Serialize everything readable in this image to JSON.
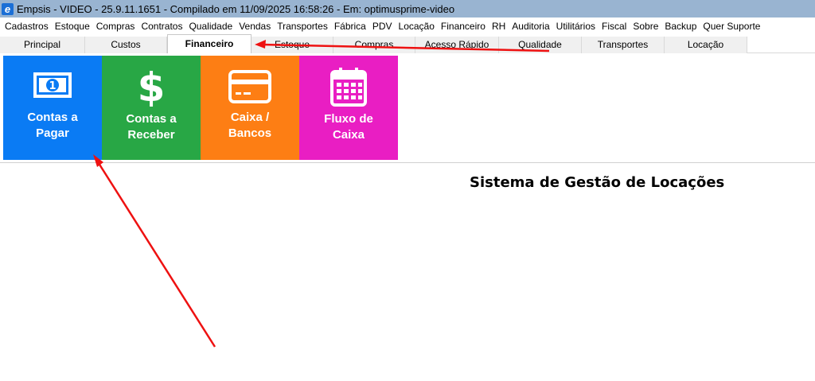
{
  "window": {
    "title": "Empsis - VIDEO - 25.9.11.1651 - Compilado em 11/09/2025 16:58:26 - Em: optimusprime-video",
    "app_icon_letter": "e"
  },
  "menu": [
    "Cadastros",
    "Estoque",
    "Compras",
    "Contratos",
    "Qualidade",
    "Vendas",
    "Transportes",
    "Fábrica",
    "PDV",
    "Locação",
    "Financeiro",
    "RH",
    "Auditoria",
    "Utilitários",
    "Fiscal",
    "Sobre",
    "Backup",
    "Quer Suporte"
  ],
  "tabs": [
    "Principal",
    "Custos",
    "Financeiro",
    "Estoque",
    "Compras",
    "Acesso Rápido",
    "Qualidade",
    "Transportes",
    "Locação"
  ],
  "active_tab": "Financeiro",
  "tiles": [
    {
      "label_line1": "Contas a",
      "label_line2": "Pagar",
      "color": "#0a7bf4",
      "icon": "banknote-icon"
    },
    {
      "label_line1": "Contas a",
      "label_line2": "Receber",
      "color": "#28a745",
      "icon": "dollar-icon"
    },
    {
      "label_line1": "Caixa /",
      "label_line2": "Bancos",
      "color": "#fd7e14",
      "icon": "credit-card-icon"
    },
    {
      "label_line1": "Fluxo de",
      "label_line2": "Caixa",
      "color": "#e91ec3",
      "icon": "calendar-icon"
    }
  ],
  "system_title": "Sistema de Gestão de Locações",
  "annotation_color": "#ee1111"
}
